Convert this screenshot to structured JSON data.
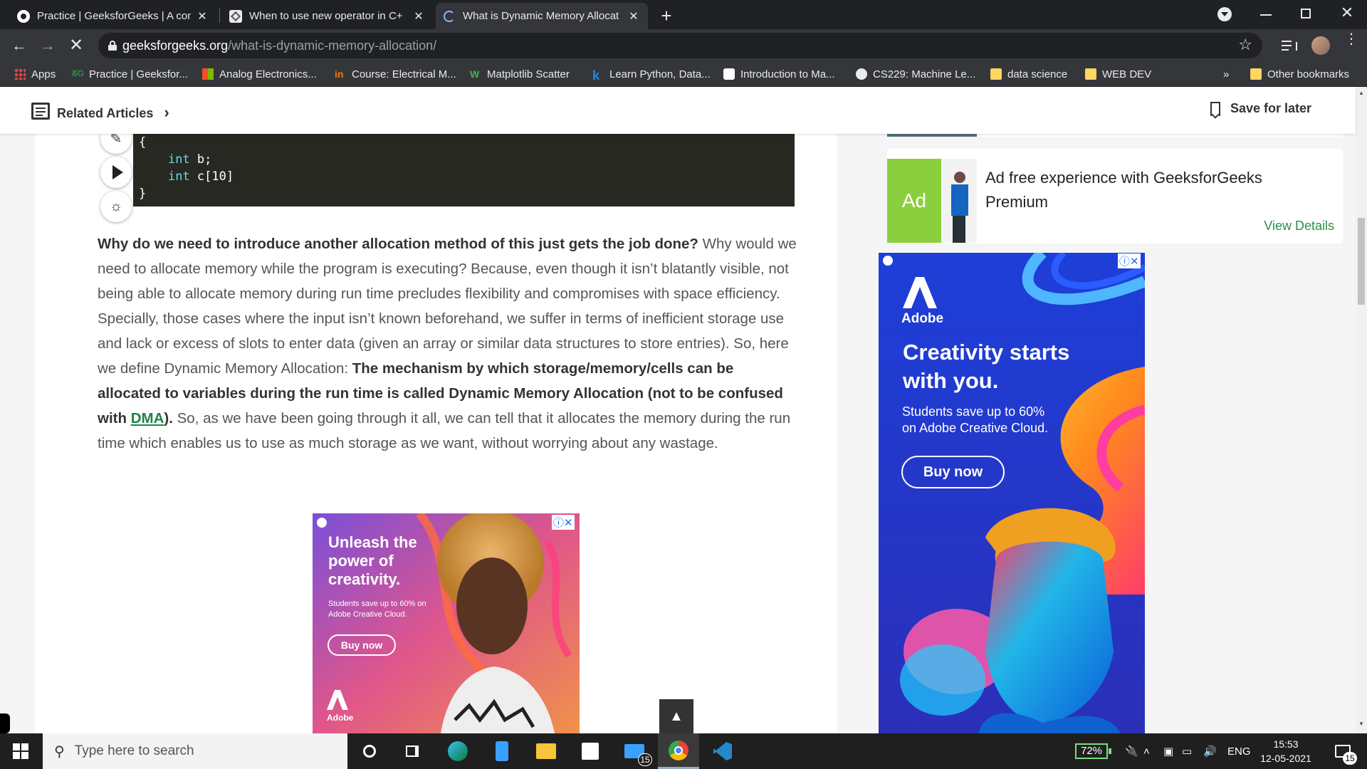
{
  "browser": {
    "tabs": [
      {
        "title": "Practice | GeeksforGeeks | A com",
        "close": "✕"
      },
      {
        "title": "When to use new operator in C+",
        "close": "✕"
      },
      {
        "title": "What is Dynamic Memory Allocat",
        "close": "✕"
      }
    ],
    "new_tab": "+",
    "url_host": "geeksforgeeks.org",
    "url_path": "/what-is-dynamic-memory-allocation/",
    "bookmarks": [
      "Apps",
      "Practice | Geeksfor...",
      "Analog Electronics...",
      "Course: Electrical M...",
      "Matplotlib Scatter",
      "Learn Python, Data...",
      "Introduction to Ma...",
      "CS229: Machine Le...",
      "data science",
      "WEB DEV"
    ],
    "bookmarks_overflow": "»",
    "other_bookmarks": "Other bookmarks"
  },
  "sticky": {
    "related": "Related Articles",
    "save": "Save for later"
  },
  "code": {
    "lines": [
      {
        "indent": "",
        "kw": "",
        "text": "{"
      },
      {
        "indent": "    ",
        "kw": "int",
        "text": " b;"
      },
      {
        "indent": "    ",
        "kw": "int",
        "text": " c[10]"
      },
      {
        "indent": "",
        "kw": "",
        "text": "}"
      }
    ]
  },
  "article": {
    "q_bold": "Why do we need to introduce another allocation method of this just gets the job done?",
    "p1": " Why would we need to allocate memory while the program is executing? Because, even though it isn’t blatantly visible, not being able to allocate memory during run time precludes flexibility and compromises with space efficiency. Specially, those cases where the input isn’t known beforehand, we suffer in terms of inefficient storage use and lack or excess of slots to enter data (given an array or similar data structures to store entries). So, here we define Dynamic Memory Allocation: ",
    "def_bold": "The mechanism by which storage/memory/cells can be allocated to variables during the run time is called Dynamic Memory Allocation (not to be confused with ",
    "link": "DMA",
    "def_end": ").",
    "p2": " So, as we have been going through it all, we can tell that it allocates the memory during the run time which enables us to use as much storage as we want, without worrying about any wastage."
  },
  "premium": {
    "badge": "Ad",
    "title": "Ad free experience with GeeksforGeeks Premium",
    "cta": "View Details"
  },
  "ad_right": {
    "brand": "Adobe",
    "headline": "Creativity starts with you.",
    "sub": "Students save up to 60% on Adobe Creative Cloud.",
    "cta": "Buy now"
  },
  "ad_left": {
    "headline": "Unleash the power of creativity.",
    "sub": "Students save up to 60% on Adobe Creative Cloud.",
    "cta": "Buy now",
    "brand": "Adobe"
  },
  "scroll_top": "▲",
  "taskbar": {
    "search_placeholder": "Type here to search",
    "mail_badge": "15",
    "battery": "72%",
    "lang": "ENG",
    "time": "15:53",
    "date": "12-05-2021",
    "notif_badge": "15"
  }
}
